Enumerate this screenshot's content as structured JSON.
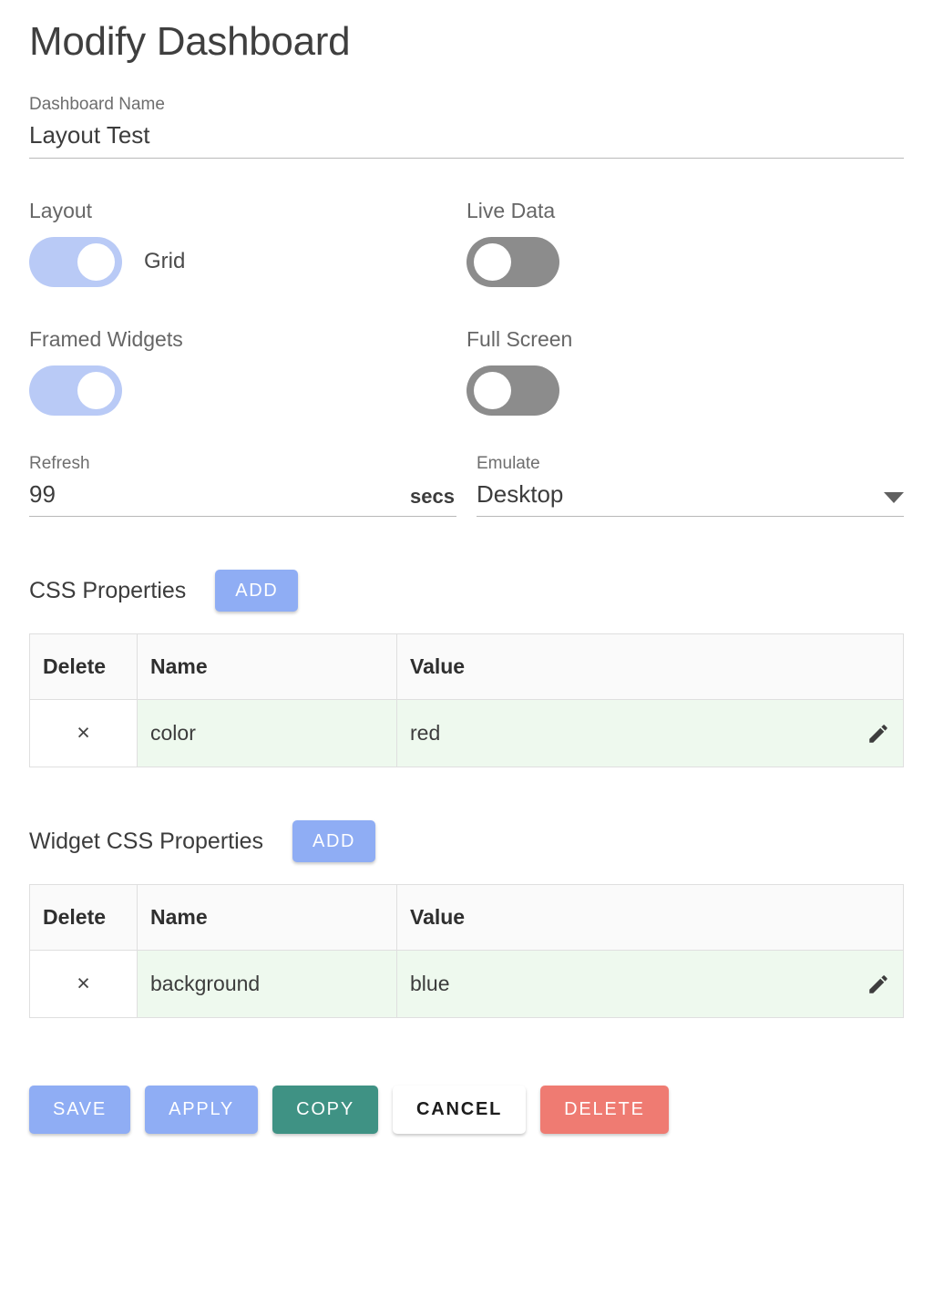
{
  "page": {
    "title": "Modify Dashboard"
  },
  "name_field": {
    "label": "Dashboard Name",
    "value": "Layout Test"
  },
  "toggles": [
    {
      "label": "Layout",
      "state": "on",
      "caption": "Grid"
    },
    {
      "label": "Live Data",
      "state": "off",
      "caption": ""
    },
    {
      "label": "Framed Widgets",
      "state": "on",
      "caption": ""
    },
    {
      "label": "Full Screen",
      "state": "off",
      "caption": ""
    }
  ],
  "refresh": {
    "label": "Refresh",
    "value": "99",
    "suffix": "secs"
  },
  "emulate": {
    "label": "Emulate",
    "value": "Desktop",
    "caret_icon": "chevron-down-icon"
  },
  "css_properties": {
    "title": "CSS Properties",
    "add_label": "ADD",
    "columns": [
      "Delete",
      "Name",
      "Value"
    ],
    "rows": [
      {
        "delete_glyph": "×",
        "name": "color",
        "value": "red",
        "edit_icon": "pencil-icon"
      }
    ]
  },
  "widget_css_properties": {
    "title": "Widget CSS Properties",
    "add_label": "ADD",
    "columns": [
      "Delete",
      "Name",
      "Value"
    ],
    "rows": [
      {
        "delete_glyph": "×",
        "name": "background",
        "value": "blue",
        "edit_icon": "pencil-icon"
      }
    ]
  },
  "actions": {
    "save": "SAVE",
    "apply": "APPLY",
    "copy": "COPY",
    "cancel": "CANCEL",
    "delete": "DELETE"
  },
  "colors": {
    "toggle_on": "#b9caf6",
    "toggle_off": "#8c8c8c",
    "accent_blue": "#8fadf4",
    "copy_green": "#3f9284",
    "delete_red": "#ef7b72",
    "row_green": "#eef9ee",
    "header_gray": "#fafafa"
  }
}
